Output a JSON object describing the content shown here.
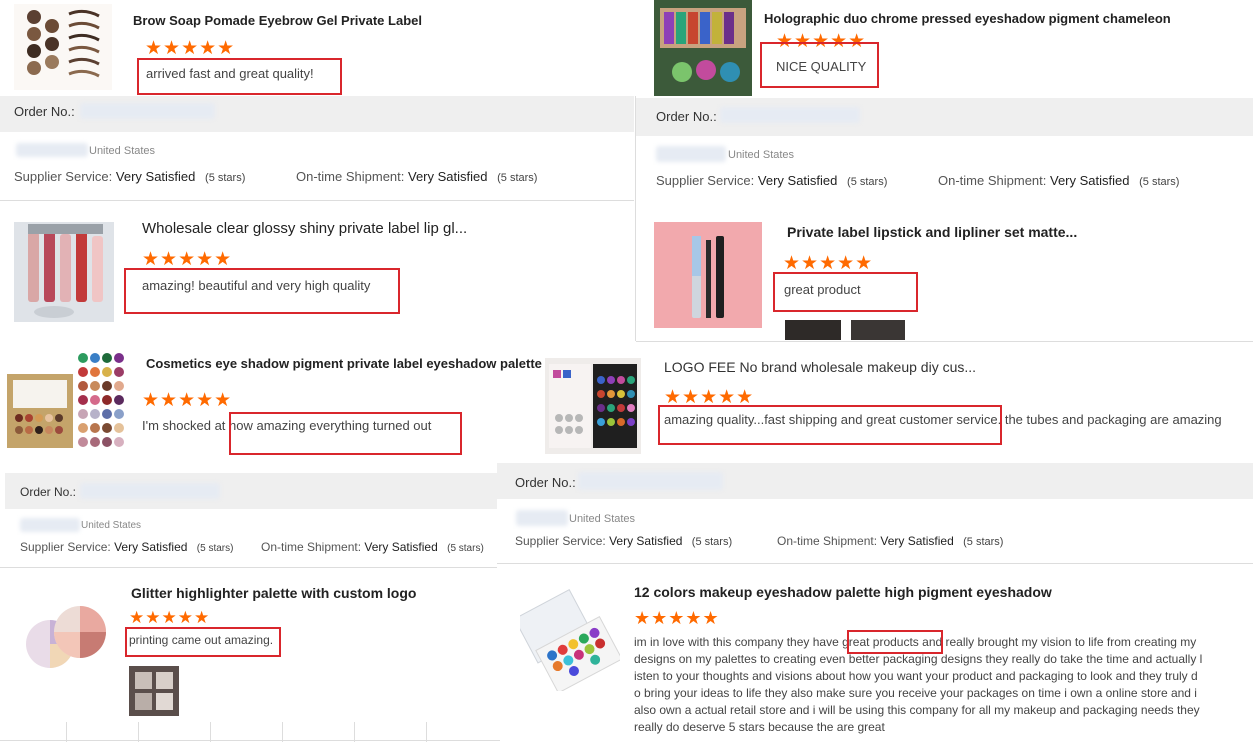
{
  "reviews": [
    {
      "title": "Brow Soap Pomade Eyebrow Gel Private Label",
      "stars": "★★★★★",
      "text": "arrived fast and great quality!"
    },
    {
      "title": "Holographic duo chrome pressed eyeshadow pigment chameleon",
      "stars": "★★★★★",
      "text": "NICE QUALITY"
    },
    {
      "title": "Wholesale clear glossy shiny private label lip gl...",
      "stars": "★★★★★",
      "text": "amazing! beautiful and very high quality"
    },
    {
      "title": "Private label lipstick and lipliner set matte...",
      "stars": "★★★★★",
      "text": "great product"
    },
    {
      "title": "Cosmetics eye shadow pigment private label eyeshadow palette",
      "stars": "★★★★★",
      "text_pre": "I'm shocked at ",
      "text_hl": "how amazing everything turned out"
    },
    {
      "title": "LOGO FEE No brand wholesale makeup diy cus...",
      "stars": "★★★★★",
      "text_hl": "amazing quality...fast shipping and great customer service. ",
      "text_post": "the tubes and packaging are amazing"
    },
    {
      "title": "Glitter highlighter palette with custom logo",
      "stars": "★★★★★",
      "text": "printing came out amazing."
    },
    {
      "title": "12 colors makeup eyeshadow palette high pigment eyeshadow",
      "stars": "★★★★★",
      "lines": [
        "im in love with this company they have  great products and really brought my vision to life from creating my",
        "designs on my palettes to creating even better packaging designs they really do take the time and actually l",
        "isten to your thoughts and visions about how you want your product and packaging to look  and they truly d",
        "o bring your  ideas to life  they also make sure you receive your packages on time  i own a online store and i",
        "also own a actual retail store and i will be using this company for all my makeup and packaging needs  they",
        "really do deserve 5 stars because the are great"
      ]
    }
  ],
  "order": {
    "label": "Order No.:"
  },
  "orders": [
    {
      "country": "United States"
    },
    {
      "country": "United States"
    },
    {
      "country": "United States"
    },
    {
      "country": "United States"
    }
  ],
  "feedback": {
    "supplier_label": "Supplier Service:",
    "shipment_label": "On-time Shipment:",
    "value": "Very Satisfied",
    "stars_note": "(5 stars)"
  },
  "colors": {
    "star": "#ff6a00",
    "highlight": "#d9262c"
  }
}
